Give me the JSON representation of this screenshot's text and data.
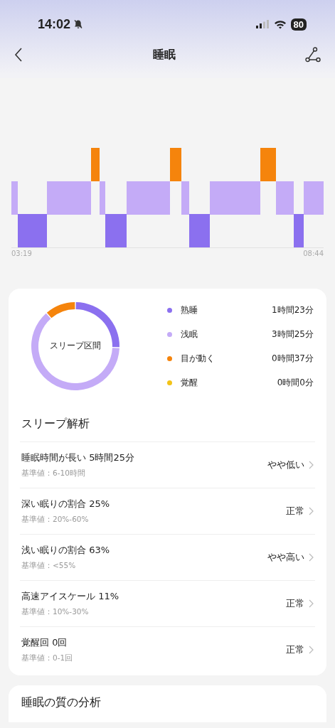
{
  "status_bar": {
    "time": "14:02",
    "battery": "80"
  },
  "header": {
    "title": "睡眠"
  },
  "timeline": {
    "start_time": "03:19",
    "end_time": "08:44"
  },
  "summary": {
    "chart_data": {
      "type": "donut",
      "title": "スリープ区間",
      "categories": [
        "熟睡",
        "浅眠",
        "目が動く",
        "覚醒"
      ],
      "values": [
        25.5,
        63.1,
        11.4,
        0
      ]
    },
    "legend": [
      {
        "value": "1時間23分",
        "color": "#8b70ef"
      },
      {
        "value": "3時間25分",
        "color": "#c4abf7"
      },
      {
        "value": "0時間37分",
        "color": "#f5840c"
      },
      {
        "value": "0時間0分",
        "color": "#f3c318"
      }
    ]
  },
  "analysis": {
    "title": "スリープ解析",
    "items": [
      {
        "label": "睡眠時間が長い 5時間25分",
        "reference": "基準値：6-10時間",
        "status": "やや低い"
      },
      {
        "label": "深い眠りの割合 25%",
        "reference": "基準値：20%-60%",
        "status": "正常"
      },
      {
        "label": "浅い眠りの割合 63%",
        "reference": "基準値：<55%",
        "status": "やや高い"
      },
      {
        "label": "高速アイスケール 11%",
        "reference": "基準値：10%-30%",
        "status": "正常"
      },
      {
        "label": "覚醒回 0回",
        "reference": "基準値：0-1回",
        "status": "正常"
      }
    ]
  },
  "quality": {
    "title": "睡眠の質の分析"
  }
}
